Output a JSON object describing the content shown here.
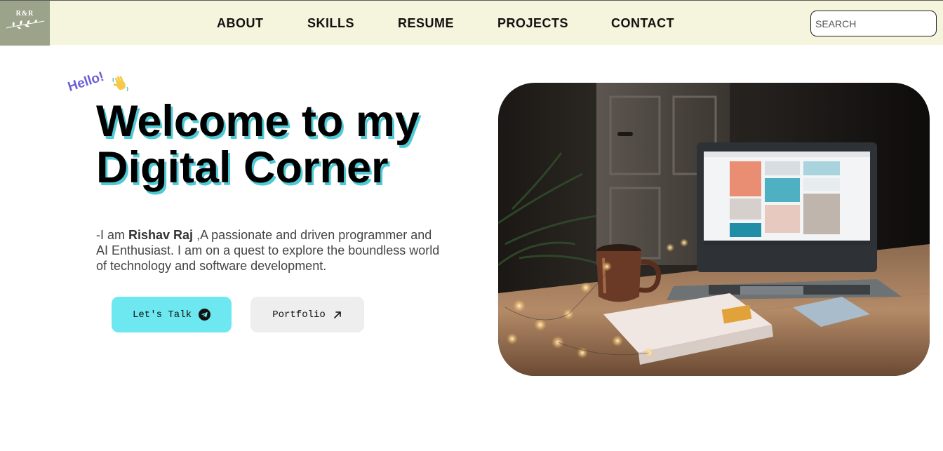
{
  "header": {
    "logo_text": "R&R",
    "nav": [
      {
        "label": "ABOUT"
      },
      {
        "label": "SKILLS"
      },
      {
        "label": "RESUME"
      },
      {
        "label": "PROJECTS"
      },
      {
        "label": "CONTACT"
      }
    ],
    "search_placeholder": "SEARCH"
  },
  "hero": {
    "hello": "Hello!",
    "headline_line1": "Welcome to my",
    "headline_line2": "Digital Corner",
    "intro_prefix": "-I am ",
    "intro_name": "Rishav Raj",
    "intro_rest": " ,A passionate and driven programmer and AI Enthusiast. I am on a quest to explore the boundless world of technology and software development.",
    "buttons": {
      "talk": "Let's Talk",
      "portfolio": "Portfolio"
    }
  },
  "icons": {
    "talk": "telegram-icon",
    "portfolio": "arrow-up-right-icon",
    "wave": "waving-hand-icon"
  },
  "colors": {
    "header_bg": "#f5f4dc",
    "logo_bg": "#9ba48a",
    "hello": "#6b5fd6",
    "headline_shadow": "#4ec9d6",
    "talk_button": "#6de8f0",
    "portfolio_button": "#eeeeee"
  }
}
